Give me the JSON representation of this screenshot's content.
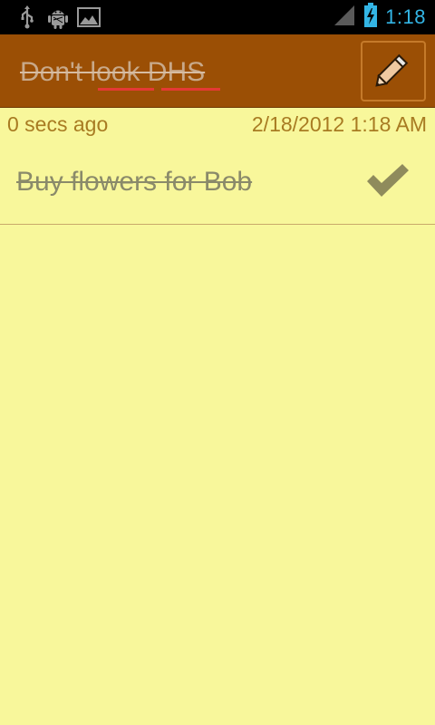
{
  "status_bar": {
    "time": "1:18",
    "icons": [
      "usb-icon",
      "android-debug-icon",
      "image-notification-icon",
      "signal-icon",
      "battery-charging-icon"
    ]
  },
  "header": {
    "title": "Don't look DHS",
    "edit_icon": "pencil-icon",
    "background_color": "#9b4f05"
  },
  "note": {
    "relative_time": "0 secs ago",
    "date": "2/18/2012 1:18 AM",
    "background_color": "#f8f79b"
  },
  "tasks": [
    {
      "label": "Buy flowers for Bob",
      "completed": true,
      "icon": "checkmark-icon"
    }
  ]
}
